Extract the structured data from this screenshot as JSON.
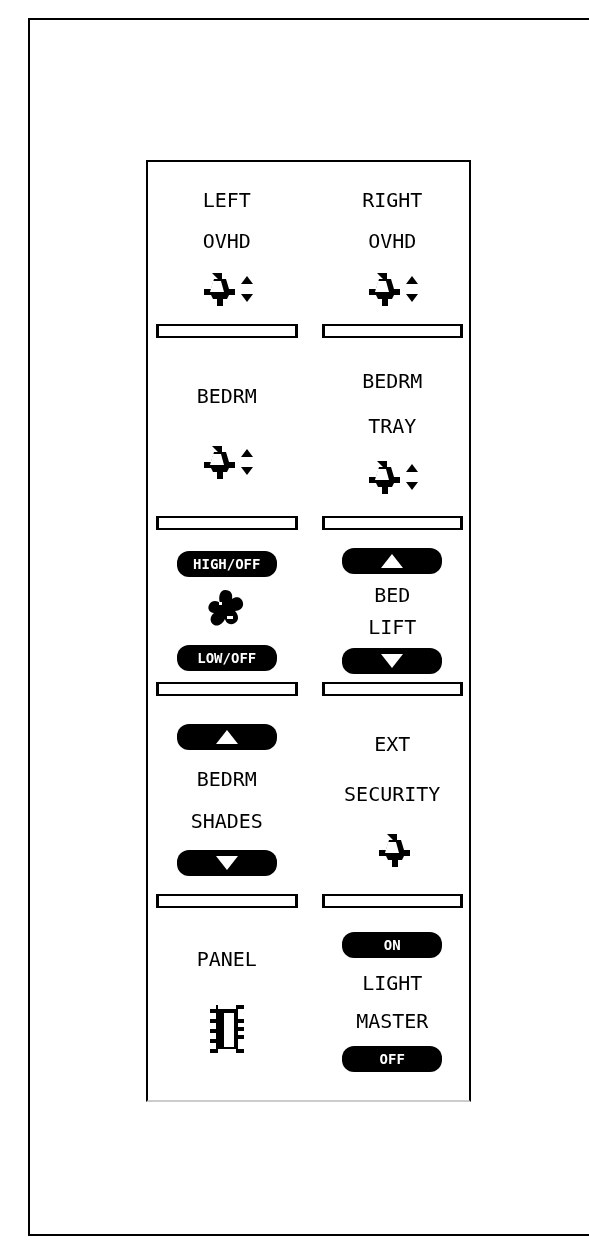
{
  "panel": {
    "rows": [
      {
        "cells": [
          {
            "kind": "dimmer",
            "labels": [
              "LEFT",
              "OVHD"
            ]
          },
          {
            "kind": "dimmer",
            "labels": [
              "RIGHT",
              "OVHD"
            ]
          }
        ]
      },
      {
        "cells": [
          {
            "kind": "dimmer",
            "labels": [
              "BEDRM"
            ]
          },
          {
            "kind": "dimmer",
            "labels": [
              "BEDRM",
              "TRAY"
            ]
          }
        ]
      },
      {
        "cells": [
          {
            "kind": "fan",
            "top_button": "HIGH/OFF",
            "bottom_button": "LOW/OFF"
          },
          {
            "kind": "updown",
            "labels": [
              "BED",
              "LIFT"
            ]
          }
        ]
      },
      {
        "cells": [
          {
            "kind": "updown",
            "labels": [
              "BEDRM",
              "SHADES"
            ]
          },
          {
            "kind": "light",
            "labels": [
              "EXT",
              "SECURITY"
            ]
          }
        ]
      },
      {
        "cells": [
          {
            "kind": "panel",
            "labels": [
              "PANEL"
            ]
          },
          {
            "kind": "onoff",
            "top_button": "ON",
            "labels": [
              "LIGHT",
              "MASTER"
            ],
            "bottom_button": "OFF"
          }
        ]
      }
    ]
  }
}
